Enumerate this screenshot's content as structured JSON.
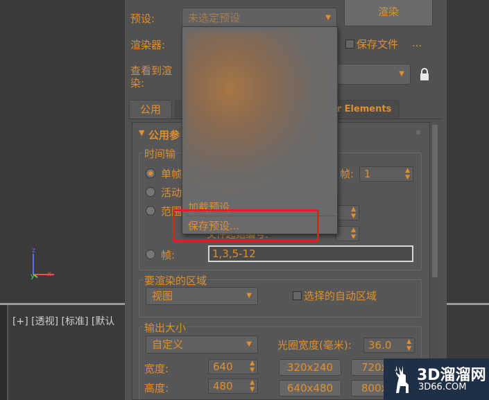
{
  "viewport": {
    "label": "[+] [透视] [标准] [默认"
  },
  "axes": {
    "x": "x",
    "y": "y",
    "z": "z"
  },
  "dialog": {
    "render_button": "渲染",
    "preset_label": "预设:",
    "preset_value": "未选定预设",
    "renderer_label": "渲染器:",
    "save_file_label": "保存文件",
    "save_file_ellipsis": "...",
    "view_to_render_label_line1": "查看到渲",
    "view_to_render_label_line2": "染:",
    "tabs": [
      "公用",
      "r Elements"
    ],
    "rollout_title": "公用参",
    "time_output_label": "时间输",
    "radio_single": "单帧",
    "radio_active": "活动",
    "radio_range": "范围",
    "radio_frames": "帧:",
    "every_n_label": "帧:",
    "every_n_value": "1",
    "file_num_label": "文件起始编号:",
    "frames_value": "1,3,5-12",
    "area_group_label": "要渲染的区域",
    "area_value": "视图",
    "auto_region_label": "选择的自动区域",
    "output_size_label": "输出大小",
    "output_size_value": "自定义",
    "aperture_label": "光圈宽度(毫米):",
    "aperture_value": "36.0",
    "width_label": "宽度:",
    "width_value": "640",
    "height_label": "高度:",
    "height_value": "480",
    "preset_sizes": [
      "320x240",
      "720x",
      "640x480",
      "800x"
    ]
  },
  "dropdown": {
    "load_preset": "加载预设...",
    "save_preset": "保存预设..."
  },
  "watermark": {
    "title": "3D溜溜网",
    "subtitle": "3D66.COM"
  }
}
